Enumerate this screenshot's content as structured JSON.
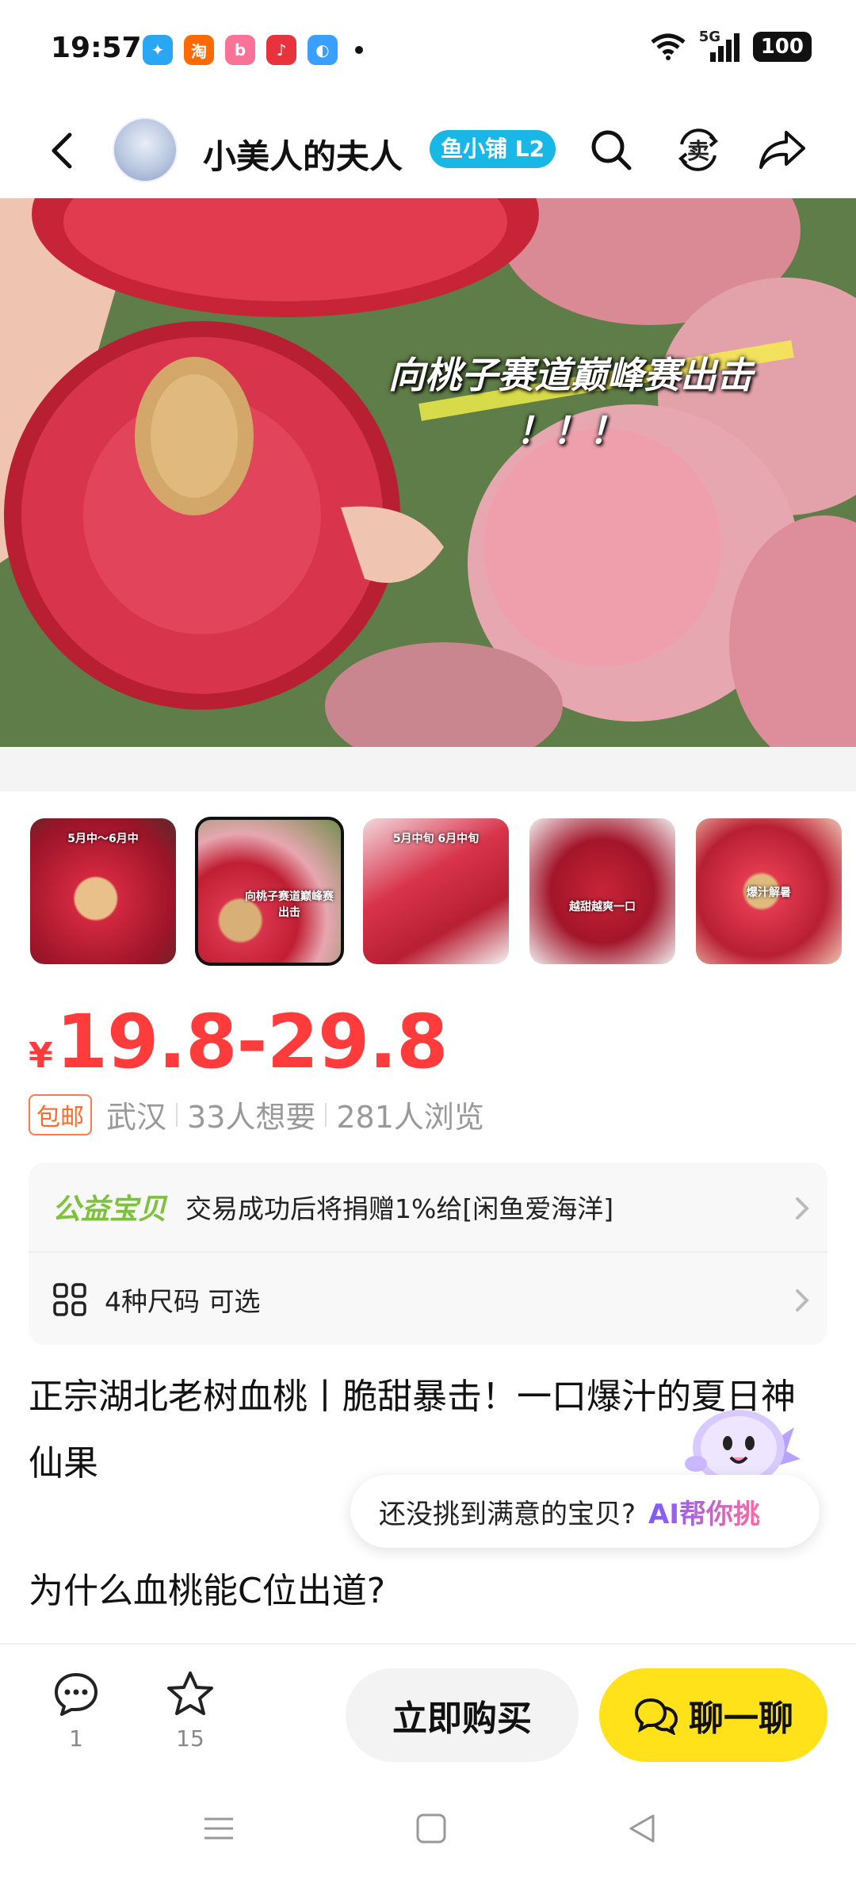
{
  "status_bar": {
    "time": "19:57",
    "signal": "5G",
    "battery": "100",
    "app_icons": [
      "qq-icon",
      "taobao-icon",
      "bilibili-icon",
      "music-icon",
      "browser-icon"
    ]
  },
  "header": {
    "shop_name": "小美人的夫人",
    "shop_badge": "鱼小铺 L2",
    "sell_label": "卖"
  },
  "hero": {
    "caption_line1": "向桃子赛道巅峰赛出击",
    "caption_line2": "！！！"
  },
  "thumbnails": [
    {
      "label": "5月中～6月中",
      "active": false
    },
    {
      "label": "向桃子赛道巅峰赛出击",
      "active": true
    },
    {
      "label": "5月中旬 6月中旬",
      "active": false
    },
    {
      "label": "越甜越爽一口",
      "active": false
    },
    {
      "label": "爆汁解暑",
      "active": false
    }
  ],
  "price": {
    "symbol": "¥",
    "value": "19.8-29.8"
  },
  "meta": {
    "free_shipping": "包邮",
    "location": "武汉",
    "wants": "33人想要",
    "views": "281人浏览"
  },
  "info": {
    "charity_label": "公益宝贝",
    "charity_text": "交易成功后将捐赠1%给[闲鱼爱海洋]",
    "sizes_text": "4种尺码 可选"
  },
  "description": {
    "title": "正宗湖北老树血桃丨脆甜暴击！一口爆汁的夏日神仙果",
    "subhead": "为什么血桃能C位出道?"
  },
  "ai_helper": {
    "prompt": "还没挑到满意的宝贝?",
    "action": "AI帮你挑"
  },
  "bottom_bar": {
    "comment_count": "1",
    "favorite_count": "15",
    "buy_label": "立即购买",
    "chat_label": "聊一聊"
  },
  "colors": {
    "price": "#ff3b3b",
    "chat_button": "#ffe21a",
    "badge": "#19b7e6",
    "charity": "#7cc23b"
  }
}
